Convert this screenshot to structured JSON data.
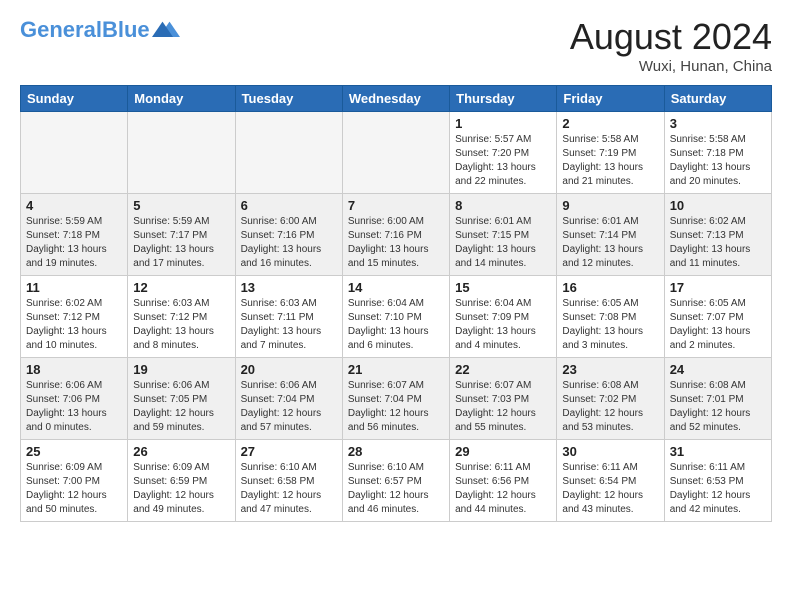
{
  "header": {
    "logo_line1": "General",
    "logo_line2": "Blue",
    "month_year": "August 2024",
    "location": "Wuxi, Hunan, China"
  },
  "weekdays": [
    "Sunday",
    "Monday",
    "Tuesday",
    "Wednesday",
    "Thursday",
    "Friday",
    "Saturday"
  ],
  "weeks": [
    [
      {
        "day": "",
        "text": "",
        "empty": true
      },
      {
        "day": "",
        "text": "",
        "empty": true
      },
      {
        "day": "",
        "text": "",
        "empty": true
      },
      {
        "day": "",
        "text": "",
        "empty": true
      },
      {
        "day": "1",
        "text": "Sunrise: 5:57 AM\nSunset: 7:20 PM\nDaylight: 13 hours\nand 22 minutes."
      },
      {
        "day": "2",
        "text": "Sunrise: 5:58 AM\nSunset: 7:19 PM\nDaylight: 13 hours\nand 21 minutes."
      },
      {
        "day": "3",
        "text": "Sunrise: 5:58 AM\nSunset: 7:18 PM\nDaylight: 13 hours\nand 20 minutes."
      }
    ],
    [
      {
        "day": "4",
        "text": "Sunrise: 5:59 AM\nSunset: 7:18 PM\nDaylight: 13 hours\nand 19 minutes."
      },
      {
        "day": "5",
        "text": "Sunrise: 5:59 AM\nSunset: 7:17 PM\nDaylight: 13 hours\nand 17 minutes."
      },
      {
        "day": "6",
        "text": "Sunrise: 6:00 AM\nSunset: 7:16 PM\nDaylight: 13 hours\nand 16 minutes."
      },
      {
        "day": "7",
        "text": "Sunrise: 6:00 AM\nSunset: 7:16 PM\nDaylight: 13 hours\nand 15 minutes."
      },
      {
        "day": "8",
        "text": "Sunrise: 6:01 AM\nSunset: 7:15 PM\nDaylight: 13 hours\nand 14 minutes."
      },
      {
        "day": "9",
        "text": "Sunrise: 6:01 AM\nSunset: 7:14 PM\nDaylight: 13 hours\nand 12 minutes."
      },
      {
        "day": "10",
        "text": "Sunrise: 6:02 AM\nSunset: 7:13 PM\nDaylight: 13 hours\nand 11 minutes."
      }
    ],
    [
      {
        "day": "11",
        "text": "Sunrise: 6:02 AM\nSunset: 7:12 PM\nDaylight: 13 hours\nand 10 minutes."
      },
      {
        "day": "12",
        "text": "Sunrise: 6:03 AM\nSunset: 7:12 PM\nDaylight: 13 hours\nand 8 minutes."
      },
      {
        "day": "13",
        "text": "Sunrise: 6:03 AM\nSunset: 7:11 PM\nDaylight: 13 hours\nand 7 minutes."
      },
      {
        "day": "14",
        "text": "Sunrise: 6:04 AM\nSunset: 7:10 PM\nDaylight: 13 hours\nand 6 minutes."
      },
      {
        "day": "15",
        "text": "Sunrise: 6:04 AM\nSunset: 7:09 PM\nDaylight: 13 hours\nand 4 minutes."
      },
      {
        "day": "16",
        "text": "Sunrise: 6:05 AM\nSunset: 7:08 PM\nDaylight: 13 hours\nand 3 minutes."
      },
      {
        "day": "17",
        "text": "Sunrise: 6:05 AM\nSunset: 7:07 PM\nDaylight: 13 hours\nand 2 minutes."
      }
    ],
    [
      {
        "day": "18",
        "text": "Sunrise: 6:06 AM\nSunset: 7:06 PM\nDaylight: 13 hours\nand 0 minutes."
      },
      {
        "day": "19",
        "text": "Sunrise: 6:06 AM\nSunset: 7:05 PM\nDaylight: 12 hours\nand 59 minutes."
      },
      {
        "day": "20",
        "text": "Sunrise: 6:06 AM\nSunset: 7:04 PM\nDaylight: 12 hours\nand 57 minutes."
      },
      {
        "day": "21",
        "text": "Sunrise: 6:07 AM\nSunset: 7:04 PM\nDaylight: 12 hours\nand 56 minutes."
      },
      {
        "day": "22",
        "text": "Sunrise: 6:07 AM\nSunset: 7:03 PM\nDaylight: 12 hours\nand 55 minutes."
      },
      {
        "day": "23",
        "text": "Sunrise: 6:08 AM\nSunset: 7:02 PM\nDaylight: 12 hours\nand 53 minutes."
      },
      {
        "day": "24",
        "text": "Sunrise: 6:08 AM\nSunset: 7:01 PM\nDaylight: 12 hours\nand 52 minutes."
      }
    ],
    [
      {
        "day": "25",
        "text": "Sunrise: 6:09 AM\nSunset: 7:00 PM\nDaylight: 12 hours\nand 50 minutes."
      },
      {
        "day": "26",
        "text": "Sunrise: 6:09 AM\nSunset: 6:59 PM\nDaylight: 12 hours\nand 49 minutes."
      },
      {
        "day": "27",
        "text": "Sunrise: 6:10 AM\nSunset: 6:58 PM\nDaylight: 12 hours\nand 47 minutes."
      },
      {
        "day": "28",
        "text": "Sunrise: 6:10 AM\nSunset: 6:57 PM\nDaylight: 12 hours\nand 46 minutes."
      },
      {
        "day": "29",
        "text": "Sunrise: 6:11 AM\nSunset: 6:56 PM\nDaylight: 12 hours\nand 44 minutes."
      },
      {
        "day": "30",
        "text": "Sunrise: 6:11 AM\nSunset: 6:54 PM\nDaylight: 12 hours\nand 43 minutes."
      },
      {
        "day": "31",
        "text": "Sunrise: 6:11 AM\nSunset: 6:53 PM\nDaylight: 12 hours\nand 42 minutes."
      }
    ]
  ]
}
